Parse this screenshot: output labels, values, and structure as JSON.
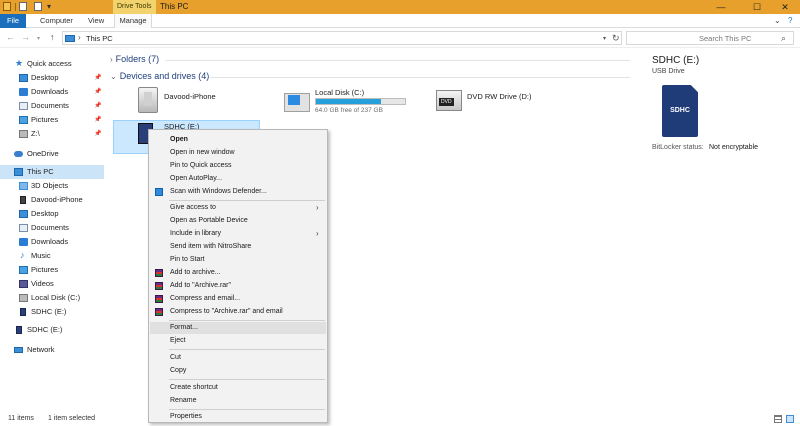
{
  "window": {
    "contextual_tab": "Drive Tools",
    "title": "This PC",
    "minimize": "—",
    "maximize": "☐",
    "close": "✕"
  },
  "ribbon": {
    "tabs": [
      "File",
      "Computer",
      "View",
      "Manage"
    ],
    "expand_glyph": "⌄",
    "help_glyph": "?"
  },
  "address": {
    "back": "←",
    "forward": "→",
    "recent": "▾",
    "up": "↑",
    "separator": "›",
    "path": "This PC",
    "dropdown": "▾",
    "refresh": "↻",
    "search_placeholder": "Search This PC",
    "search_glyph": "⌕"
  },
  "sidebar": {
    "pin_glyph": "📌",
    "items": [
      {
        "label": "Quick access",
        "icon": "star-icon",
        "pinned": false
      },
      {
        "label": "Desktop",
        "icon": "desktop-icon",
        "pinned": true
      },
      {
        "label": "Downloads",
        "icon": "download-icon",
        "pinned": true
      },
      {
        "label": "Documents",
        "icon": "document-icon",
        "pinned": true
      },
      {
        "label": "Pictures",
        "icon": "picture-icon",
        "pinned": true
      },
      {
        "label": "Z:\\",
        "icon": "drive-icon",
        "pinned": true
      },
      {
        "label": "OneDrive",
        "icon": "cloud-icon"
      },
      {
        "label": "This PC",
        "icon": "computer-icon",
        "selected": true
      },
      {
        "label": "3D Objects",
        "icon": "cube-icon"
      },
      {
        "label": "Davood-iPhone",
        "icon": "phone-icon"
      },
      {
        "label": "Desktop",
        "icon": "desktop-icon"
      },
      {
        "label": "Documents",
        "icon": "document-icon"
      },
      {
        "label": "Downloads",
        "icon": "download-icon"
      },
      {
        "label": "Music",
        "icon": "music-icon"
      },
      {
        "label": "Pictures",
        "icon": "picture-icon"
      },
      {
        "label": "Videos",
        "icon": "video-icon"
      },
      {
        "label": "Local Disk (C:)",
        "icon": "drive-icon"
      },
      {
        "label": "SDHC (E:)",
        "icon": "sd-card-icon"
      },
      {
        "label": "SDHC (E:)",
        "icon": "sd-card-icon"
      },
      {
        "label": "Network",
        "icon": "network-icon"
      }
    ]
  },
  "content": {
    "group_chevron_collapsed": "›",
    "group_chevron_expanded": "⌄",
    "folders_header": "Folders (7)",
    "devices_header": "Devices and drives (4)",
    "devices": {
      "iphone": "Davood-iPhone",
      "local_disk": {
        "name": "Local Disk (C:)",
        "free_text": "64.0 GB free of 237 GB",
        "used_fraction": 0.73
      },
      "dvd": {
        "name": "DVD RW Drive (D:)",
        "badge": "DVD"
      },
      "sdhc": {
        "name": "SDHC (E:)"
      }
    }
  },
  "details": {
    "title": "SDHC (E:)",
    "subtitle": "USB Drive",
    "card_label": "SDHC",
    "bitlocker_label": "BitLocker status:",
    "bitlocker_value": "Not encryptable"
  },
  "context_menu": {
    "submenu_glyph": "›",
    "items": {
      "open": "Open",
      "open_new_window": "Open in new window",
      "pin_quick_access": "Pin to Quick access",
      "open_autoplay": "Open AutoPlay...",
      "scan_defender": "Scan with Windows Defender...",
      "give_access": "Give access to",
      "open_portable": "Open as Portable Device",
      "include_library": "Include in library",
      "send_nitroshare": "Send item with NitroShare",
      "pin_start": "Pin to Start",
      "add_archive": "Add to archive...",
      "add_archive_rar": "Add to \"Archive.rar\"",
      "compress_email": "Compress and email...",
      "compress_rar_email": "Compress to \"Archive.rar\" and email",
      "format": "Format...",
      "eject": "Eject",
      "cut": "Cut",
      "copy": "Copy",
      "create_shortcut": "Create shortcut",
      "rename": "Rename",
      "properties": "Properties"
    }
  },
  "status": {
    "count": "11 items",
    "selected": "1 item selected"
  },
  "colors": {
    "titlebar": "#e6a02b",
    "accent": "#1a6fbd",
    "selection": "#cce8ff",
    "disk_fill": "#26a0da"
  }
}
